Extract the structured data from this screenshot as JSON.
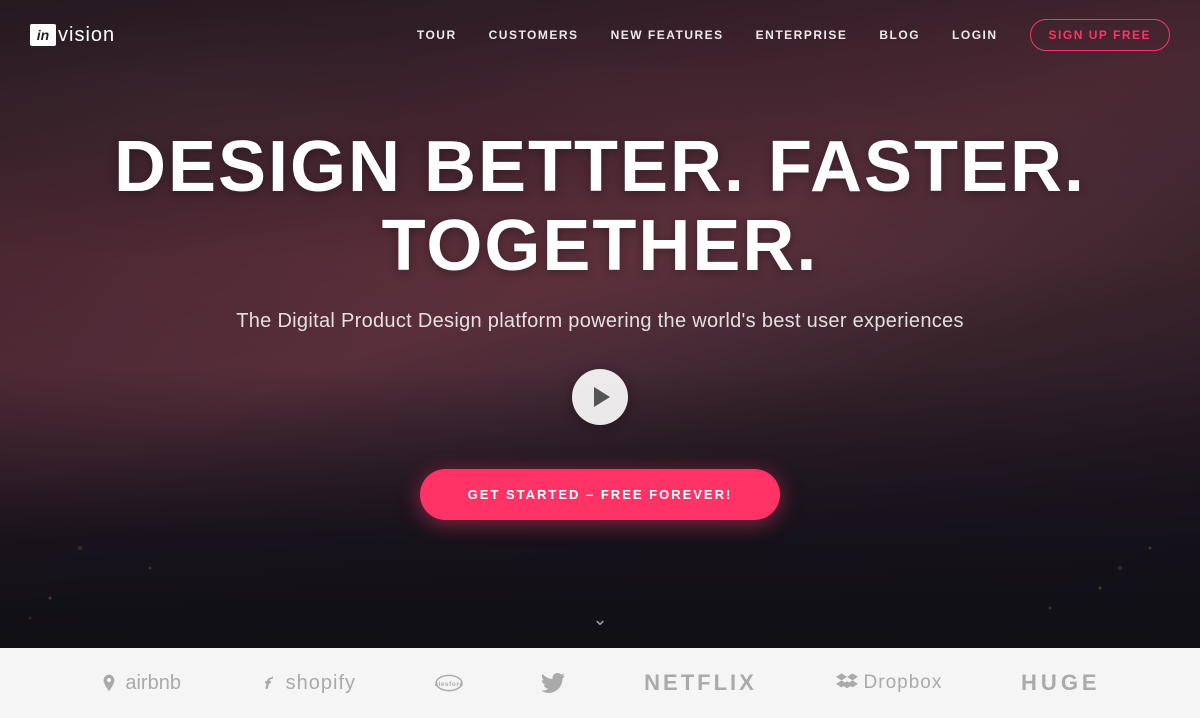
{
  "logo": {
    "box_text": "in",
    "text": "vision"
  },
  "nav": {
    "items": [
      {
        "label": "TOUR",
        "id": "tour"
      },
      {
        "label": "CUSTOMERS",
        "id": "customers"
      },
      {
        "label": "NEW FEATURES",
        "id": "new-features"
      },
      {
        "label": "ENTERPRISE",
        "id": "enterprise"
      },
      {
        "label": "BLOG",
        "id": "blog"
      },
      {
        "label": "LOGIN",
        "id": "login"
      }
    ],
    "signup_label": "SIGN UP FREE"
  },
  "hero": {
    "headline": "DESIGN BETTER. FASTER. TOGETHER.",
    "subheadline": "The Digital Product Design platform powering the world's best user experiences",
    "cta_label": "GET STARTED – FREE FOREVER!",
    "scroll_icon": "∨"
  },
  "brands": [
    {
      "name": "airbnb",
      "label": "airbnb",
      "icon": "airbnb"
    },
    {
      "name": "shopify",
      "label": "shopify",
      "icon": "shopify"
    },
    {
      "name": "salesforce",
      "label": "salesforce",
      "icon": "salesforce"
    },
    {
      "name": "twitter",
      "label": "twitter",
      "icon": "twitter"
    },
    {
      "name": "netflix",
      "label": "NETFLIX",
      "icon": "netflix"
    },
    {
      "name": "dropbox",
      "label": "Dropbox",
      "icon": "dropbox"
    },
    {
      "name": "huge",
      "label": "HUGE",
      "icon": "huge"
    }
  ],
  "colors": {
    "accent": "#ff3366",
    "hero_overlay": "rgba(20,15,20,0.55)",
    "logo_bar_bg": "#f5f5f5"
  }
}
